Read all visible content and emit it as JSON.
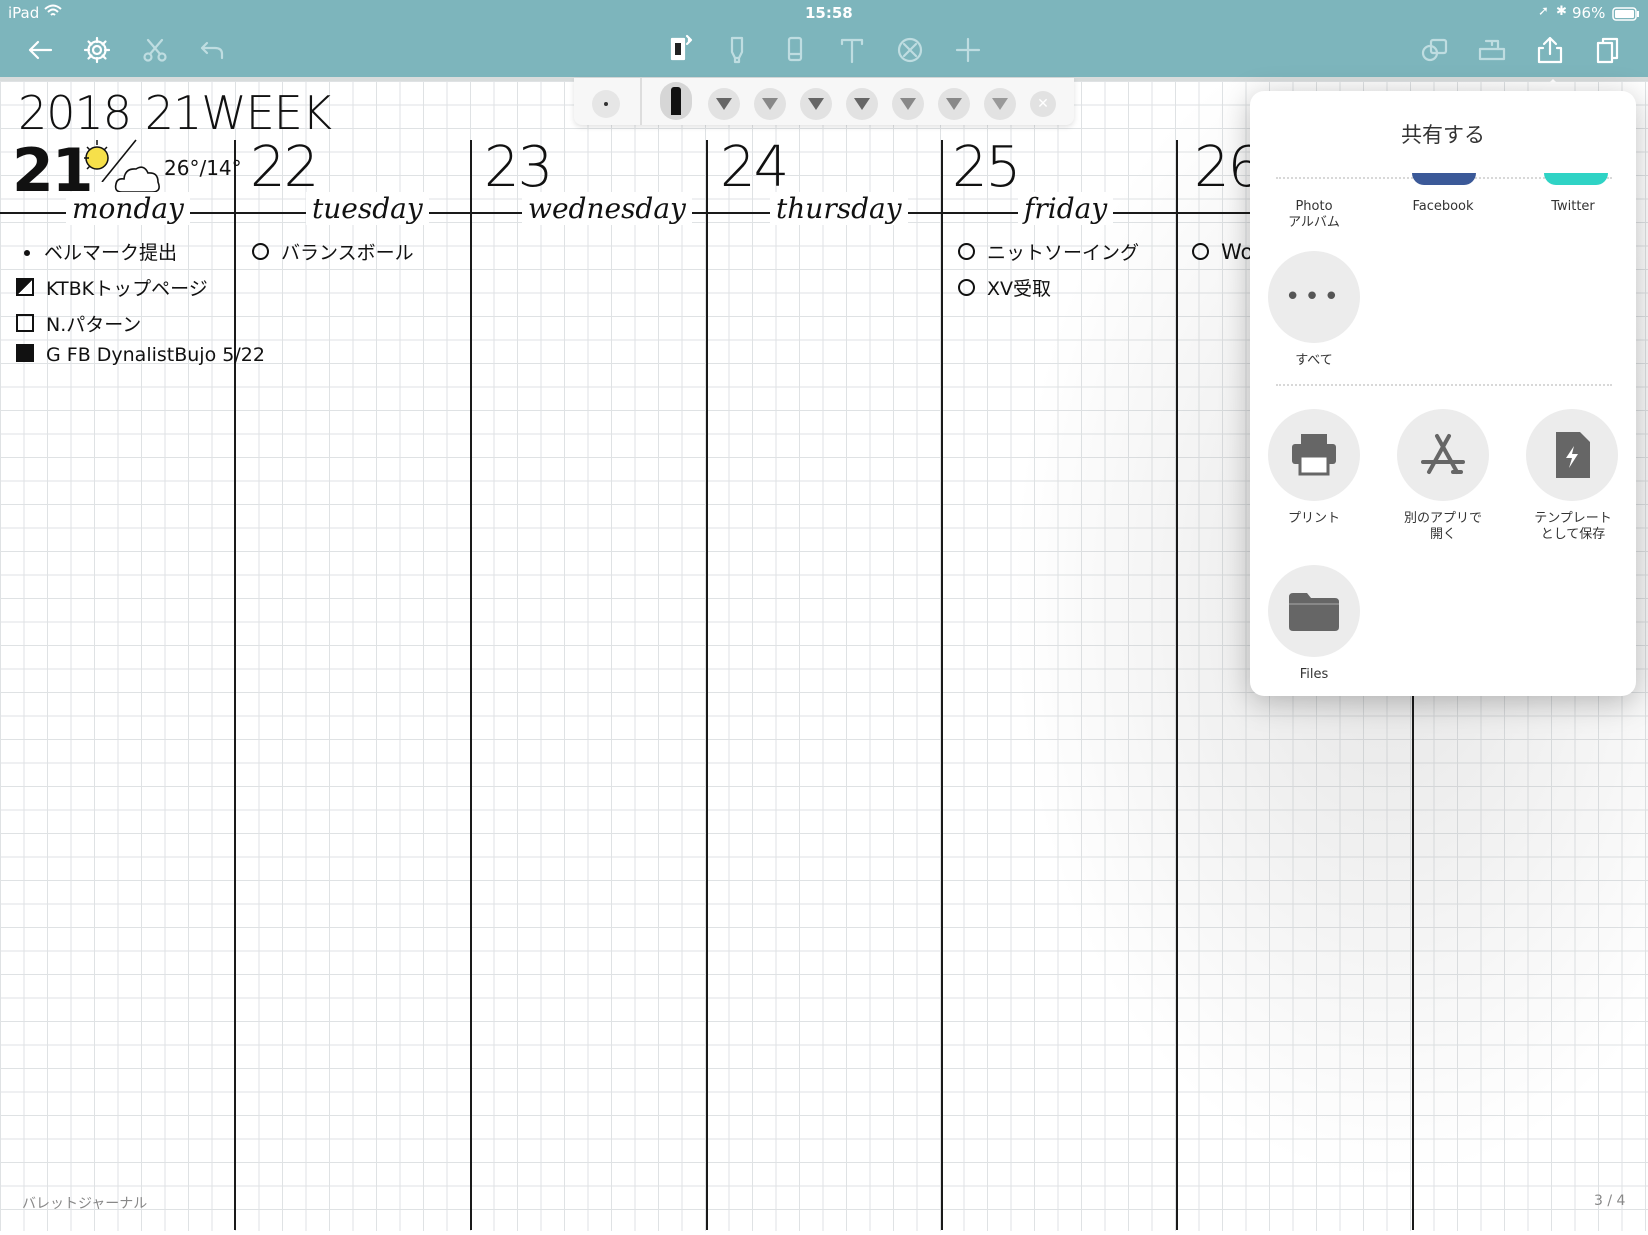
{
  "status_bar": {
    "device": "iPad",
    "time": "15:58",
    "battery": "96%"
  },
  "toolbar": {
    "left": [
      "back-icon",
      "gear-icon",
      "scissors-icon",
      "undo-icon"
    ],
    "center": [
      "pen-bluetooth-icon",
      "highlighter-icon",
      "eraser-icon",
      "text-icon",
      "lasso-icon",
      "add-icon"
    ],
    "right": [
      "shape-icon",
      "ruler-icon",
      "share-icon",
      "pages-icon"
    ]
  },
  "journal": {
    "title": "2018 21WEEK",
    "weather_temp": "26°/14°",
    "days": [
      {
        "num": "21",
        "name": "monday"
      },
      {
        "num": "22",
        "name": "tuesday"
      },
      {
        "num": "23",
        "name": "wednesday"
      },
      {
        "num": "24",
        "name": "thursday"
      },
      {
        "num": "25",
        "name": "friday"
      },
      {
        "num": "26",
        "name": ""
      }
    ],
    "monday_tasks": [
      "ベルマーク提出",
      "KTBKトップページ",
      "N.パターン",
      "G FB DynalistBujo 5/22"
    ],
    "tuesday_tasks": [
      "バランスボール"
    ],
    "friday_tasks": [
      "ニットソーイング",
      "XV受取"
    ],
    "saturday_tasks": [
      "Wor"
    ]
  },
  "share_sheet": {
    "title": "共有する",
    "apps": [
      {
        "label": "Photo\nアルバム"
      },
      {
        "label": "Facebook"
      },
      {
        "label": "Twitter"
      }
    ],
    "more_label": "すべて",
    "actions": [
      {
        "label": "プリント"
      },
      {
        "label": "別のアプリで\n開く"
      },
      {
        "label": "テンプレート\nとして保存"
      },
      {
        "label": "Files"
      }
    ]
  },
  "footer": {
    "notebook": "バレットジャーナル",
    "page": "3 / 4"
  },
  "colors": {
    "toolbar": "#7db5bc",
    "sun": "#f6e04a",
    "facebook": "#3b5998",
    "twitter": "#2fd3c5"
  }
}
